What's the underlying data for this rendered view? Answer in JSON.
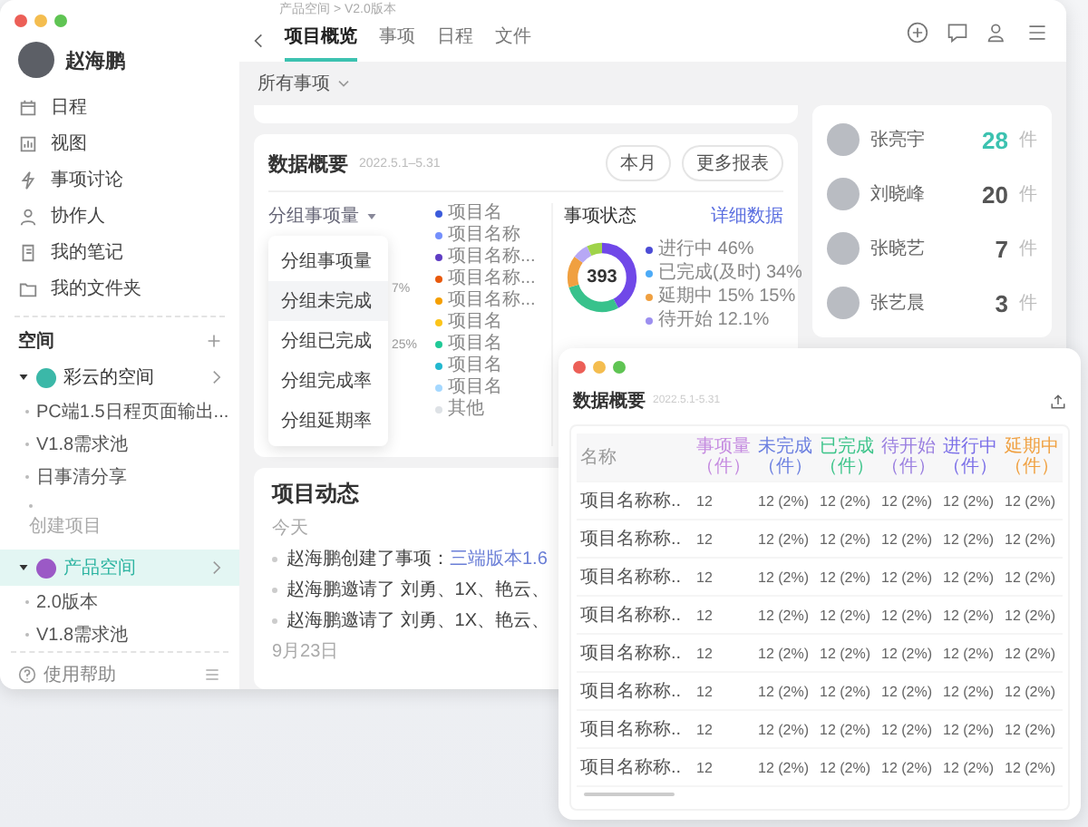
{
  "sidebar": {
    "user": "赵海鹏",
    "nav": [
      {
        "label": "日程"
      },
      {
        "label": "视图"
      },
      {
        "label": "事项讨论"
      },
      {
        "label": "协作人"
      },
      {
        "label": "我的笔记"
      },
      {
        "label": "我的文件夹"
      }
    ],
    "spaces_title": "空间",
    "spaces": [
      {
        "label": "彩云的空间",
        "color": "#3bb8a8",
        "expanded": true,
        "selected": false,
        "children": [
          {
            "label": "PC端1.5日程页面输出...",
            "kind": "project"
          },
          {
            "label": "V1.8需求池",
            "kind": "project"
          },
          {
            "label": "日事清分享",
            "kind": "project"
          },
          {
            "label": "创建项目",
            "kind": "action"
          }
        ]
      },
      {
        "label": "产品空间",
        "color": "#9b59c6",
        "expanded": true,
        "selected": true,
        "children": [
          {
            "label": "2.0版本",
            "kind": "project"
          },
          {
            "label": "V1.8需求池",
            "kind": "project"
          }
        ]
      }
    ],
    "help": "使用帮助"
  },
  "breadcrumb": "产品空间 > V2.0版本",
  "tabs": [
    {
      "label": "项目概览",
      "selected": true
    },
    {
      "label": "事项",
      "selected": false
    },
    {
      "label": "日程",
      "selected": false
    },
    {
      "label": "文件",
      "selected": false
    }
  ],
  "filter": "所有事项",
  "overview": {
    "title": "数据概要",
    "date": "2022.5.1–5.31",
    "buttons": [
      "本月",
      "更多报表"
    ],
    "group_select": "分组事项量",
    "menu": [
      {
        "label": "分组事项量",
        "selected": false
      },
      {
        "label": "分组未完成",
        "selected": true
      },
      {
        "label": "分组已完成",
        "selected": false
      },
      {
        "label": "分组完成率",
        "selected": false
      },
      {
        "label": "分组延期率",
        "selected": false
      }
    ],
    "pie_labels": [
      "7%",
      "25%"
    ],
    "legend": [
      {
        "label": "项目名",
        "color": "#3b5bdb"
      },
      {
        "label": "项目名称",
        "color": "#748ffc"
      },
      {
        "label": "项目名称...",
        "color": "#5f3dc4"
      },
      {
        "label": "项目名称...",
        "color": "#e8590c"
      },
      {
        "label": "项目名称...",
        "color": "#f59f00"
      },
      {
        "label": "项目名",
        "color": "#fcc419"
      },
      {
        "label": "项目名",
        "color": "#20c997"
      },
      {
        "label": "项目名",
        "color": "#22b8cf"
      },
      {
        "label": "项目名",
        "color": "#a5d8ff"
      },
      {
        "label": "其他",
        "color": "#dee2e6"
      }
    ],
    "status": {
      "title": "事项状态",
      "link": "详细数据",
      "total": "393",
      "legend": [
        {
          "label": "进行中 46%",
          "color": "#4c4cd6"
        },
        {
          "label": "已完成(及时) 34%",
          "color": "#4dabf7"
        },
        {
          "label": "延期中 15% 15%",
          "color": "#f0a040"
        },
        {
          "label": "待开始 12.1%",
          "color": "#9c8ff0"
        }
      ]
    }
  },
  "people": [
    {
      "name": "张亮宇",
      "count": "28",
      "unit": "件",
      "highlighted": true
    },
    {
      "name": "刘晓峰",
      "count": "20",
      "unit": "件",
      "highlighted": false
    },
    {
      "name": "张晓艺",
      "count": "7",
      "unit": "件",
      "highlighted": false
    },
    {
      "name": "张艺晨",
      "count": "3",
      "unit": "件",
      "highlighted": false
    }
  ],
  "activity": {
    "title": "项目动态",
    "groups": [
      {
        "date": "今天",
        "items": [
          {
            "text": "赵海鹏创建了事项：",
            "link": "三端版本1.6"
          },
          {
            "text": "赵海鹏邀请了 刘勇、1X、艳云、"
          },
          {
            "text": "赵海鹏邀请了 刘勇、1X、艳云、"
          }
        ]
      },
      {
        "date": "9月23日"
      }
    ]
  },
  "report": {
    "title": "数据概要",
    "date": "2022.5.1-5.31",
    "columns": [
      {
        "label": "名称",
        "color": "#999999"
      },
      {
        "label": "事项量（件）",
        "color": "#c58be0"
      },
      {
        "label": "未完成（件）",
        "color": "#6b7fe0"
      },
      {
        "label": "已完成（件）",
        "color": "#3cc48a"
      },
      {
        "label": "待开始（件）",
        "color": "#9a7fe0"
      },
      {
        "label": "进行中（件）",
        "color": "#7a6ee8"
      },
      {
        "label": "延期中（件）",
        "color": "#f0a040"
      }
    ],
    "rows": [
      [
        "项目名称称..",
        "12",
        "12 (2%)",
        "12 (2%)",
        "12 (2%)",
        "12 (2%)",
        "12 (2%)"
      ],
      [
        "项目名称称..",
        "12",
        "12 (2%)",
        "12 (2%)",
        "12 (2%)",
        "12 (2%)",
        "12 (2%)"
      ],
      [
        "项目名称称..",
        "12",
        "12 (2%)",
        "12 (2%)",
        "12 (2%)",
        "12 (2%)",
        "12 (2%)"
      ],
      [
        "项目名称称..",
        "12",
        "12 (2%)",
        "12 (2%)",
        "12 (2%)",
        "12 (2%)",
        "12 (2%)"
      ],
      [
        "项目名称称..",
        "12",
        "12 (2%)",
        "12 (2%)",
        "12 (2%)",
        "12 (2%)",
        "12 (2%)"
      ],
      [
        "项目名称称..",
        "12",
        "12 (2%)",
        "12 (2%)",
        "12 (2%)",
        "12 (2%)",
        "12 (2%)"
      ],
      [
        "项目名称称..",
        "12",
        "12 (2%)",
        "12 (2%)",
        "12 (2%)",
        "12 (2%)",
        "12 (2%)"
      ],
      [
        "项目名称称..",
        "12",
        "12 (2%)",
        "12 (2%)",
        "12 (2%)",
        "12 (2%)",
        "12 (2%)"
      ]
    ]
  }
}
